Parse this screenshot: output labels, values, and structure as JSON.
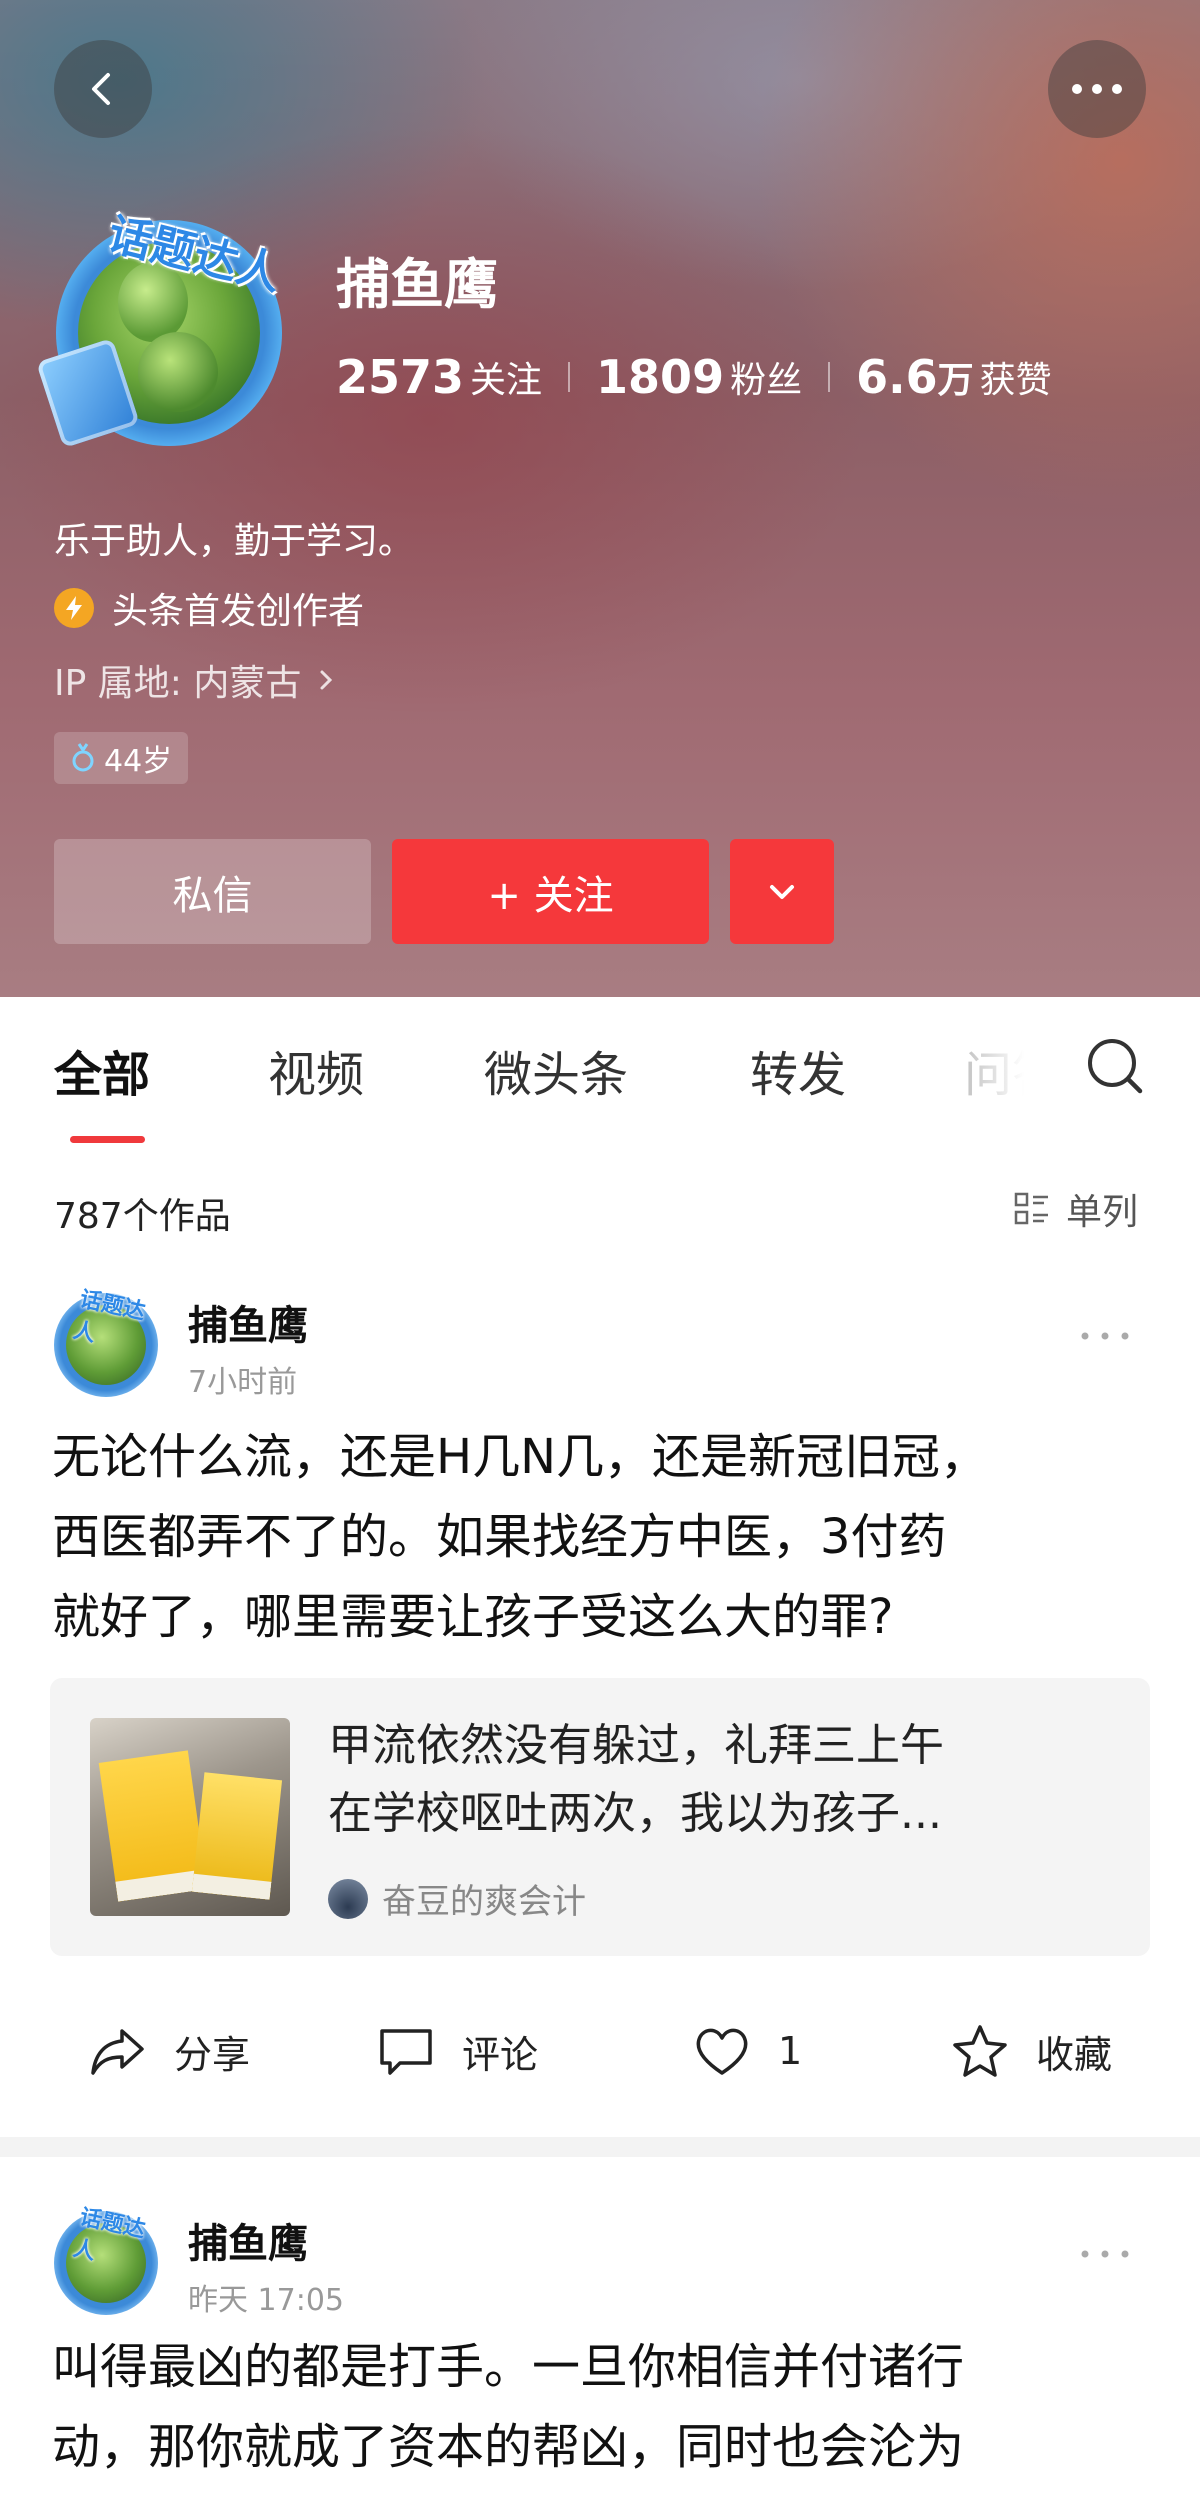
{
  "header": {
    "username": "捕鱼鹰",
    "avatar_badge": "话题达人",
    "stats": {
      "following_num": "2573",
      "following_label": "关注",
      "followers_num": "1809",
      "followers_label": "粉丝",
      "likes_num": "6.6",
      "likes_unit": "万",
      "likes_label": "获赞"
    },
    "bio": "乐于助人，勤于学习。",
    "creator_label": "头条首发创作者",
    "ip_label": "IP 属地: 内蒙古",
    "age": "44岁",
    "message_button": "私信",
    "follow_button": "+ 关注"
  },
  "tabs": [
    {
      "label": "全部"
    },
    {
      "label": "视频"
    },
    {
      "label": "微头条"
    },
    {
      "label": "转发"
    },
    {
      "label": "问答"
    }
  ],
  "content_bar": {
    "count": "787个作品",
    "view_mode": "单列"
  },
  "posts": [
    {
      "author": "捕鱼鹰",
      "time": "7小时前",
      "lines": [
        "无论什么流，还是H几N几，还是新冠旧冠，",
        "西医都弄不了的。如果找经方中医，3付药",
        "就好了，哪里需要让孩子受这么大的罪?"
      ],
      "quote": {
        "lines": [
          "甲流依然没有躲过，礼拜三上午",
          "在学校呕吐两次，我以为孩子..."
        ],
        "source": "奋豆的爽会计"
      },
      "actions": {
        "share": "分享",
        "comment": "评论",
        "likes": "1",
        "favorite": "收藏"
      }
    },
    {
      "author": "捕鱼鹰",
      "time": "昨天 17:05",
      "lines": [
        "叫得最凶的都是打手。一旦你相信并付诸行",
        "动，那你就成了资本的帮凶，同时也会沦为"
      ]
    }
  ],
  "colors": {
    "accent_red": "#f5383b",
    "tab_underline": "#f0393c",
    "badge_blue": "#2d88e6",
    "creator_orange": "#f4a623"
  }
}
